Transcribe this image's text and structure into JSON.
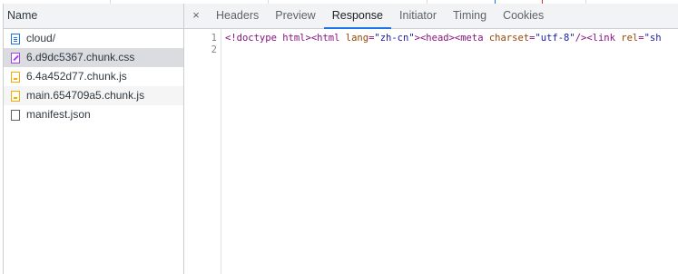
{
  "name_panel": {
    "header": "Name",
    "files": [
      {
        "name": "cloud/",
        "icon": "document-icon"
      },
      {
        "name": "6.d9dc5367.chunk.css",
        "icon": "stylesheet-icon"
      },
      {
        "name": "6.4a452d77.chunk.js",
        "icon": "script-icon"
      },
      {
        "name": "main.654709a5.chunk.js",
        "icon": "script-icon"
      },
      {
        "name": "manifest.json",
        "icon": "file-icon"
      }
    ]
  },
  "detail_panel": {
    "close_glyph": "×",
    "tabs": [
      "Headers",
      "Preview",
      "Response",
      "Initiator",
      "Timing",
      "Cookies"
    ],
    "active_tab": "Response",
    "line_numbers": [
      "1",
      "2"
    ],
    "code": {
      "line1": {
        "t1": "<!doctype html>",
        "t2": "<html ",
        "a1": "lang",
        "eq1": "=",
        "v1": "\"zh-cn\"",
        "t3": "><head><meta ",
        "a2": "charset",
        "eq2": "=",
        "v2": "\"utf-8\"",
        "t4": "/><link ",
        "a3": "rel",
        "eq3": "=",
        "v3": "\"sh"
      },
      "line2": ""
    }
  },
  "colors": {
    "accent": "#1a73e8",
    "selected_row": "#dadce0",
    "panel_header": "#f1f3f4",
    "tag": "#881280",
    "attr_value": "#1a1aa6"
  }
}
